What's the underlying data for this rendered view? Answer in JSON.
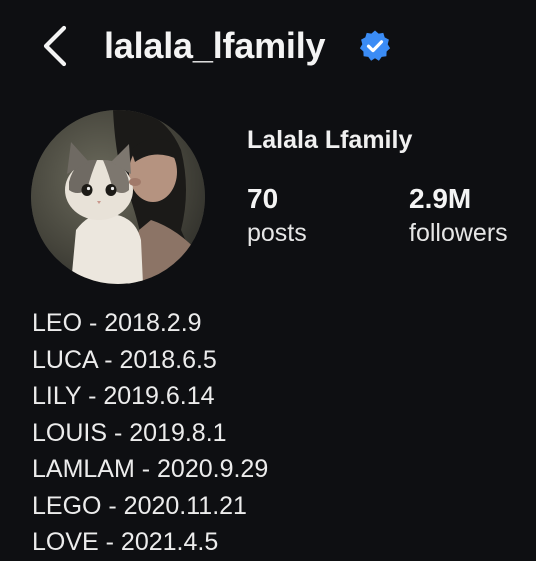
{
  "header": {
    "back_icon": "chevron-left-icon",
    "username": "lalala_lfamily",
    "verified_icon": "verified-badge-icon",
    "verified_color": "#3b8cf5"
  },
  "profile": {
    "display_name": "Lalala Lfamily",
    "avatar_icon": "profile-avatar-photo"
  },
  "stats": {
    "posts_count": "70",
    "posts_label": "posts",
    "followers_count": "2.9M",
    "followers_label": "followers"
  },
  "bio": {
    "lines": [
      "LEO - 2018.2.9",
      "LUCA - 2018.6.5",
      "LILY - 2019.6.14",
      "LOUIS - 2019.8.1",
      "LAMLAM - 2020.9.29",
      "LEGO - 2020.11.21",
      "LOVE - 2021.4.5"
    ]
  },
  "colors": {
    "background": "#0e0f12",
    "text": "#f2f2f2",
    "accent": "#3b8cf5"
  }
}
